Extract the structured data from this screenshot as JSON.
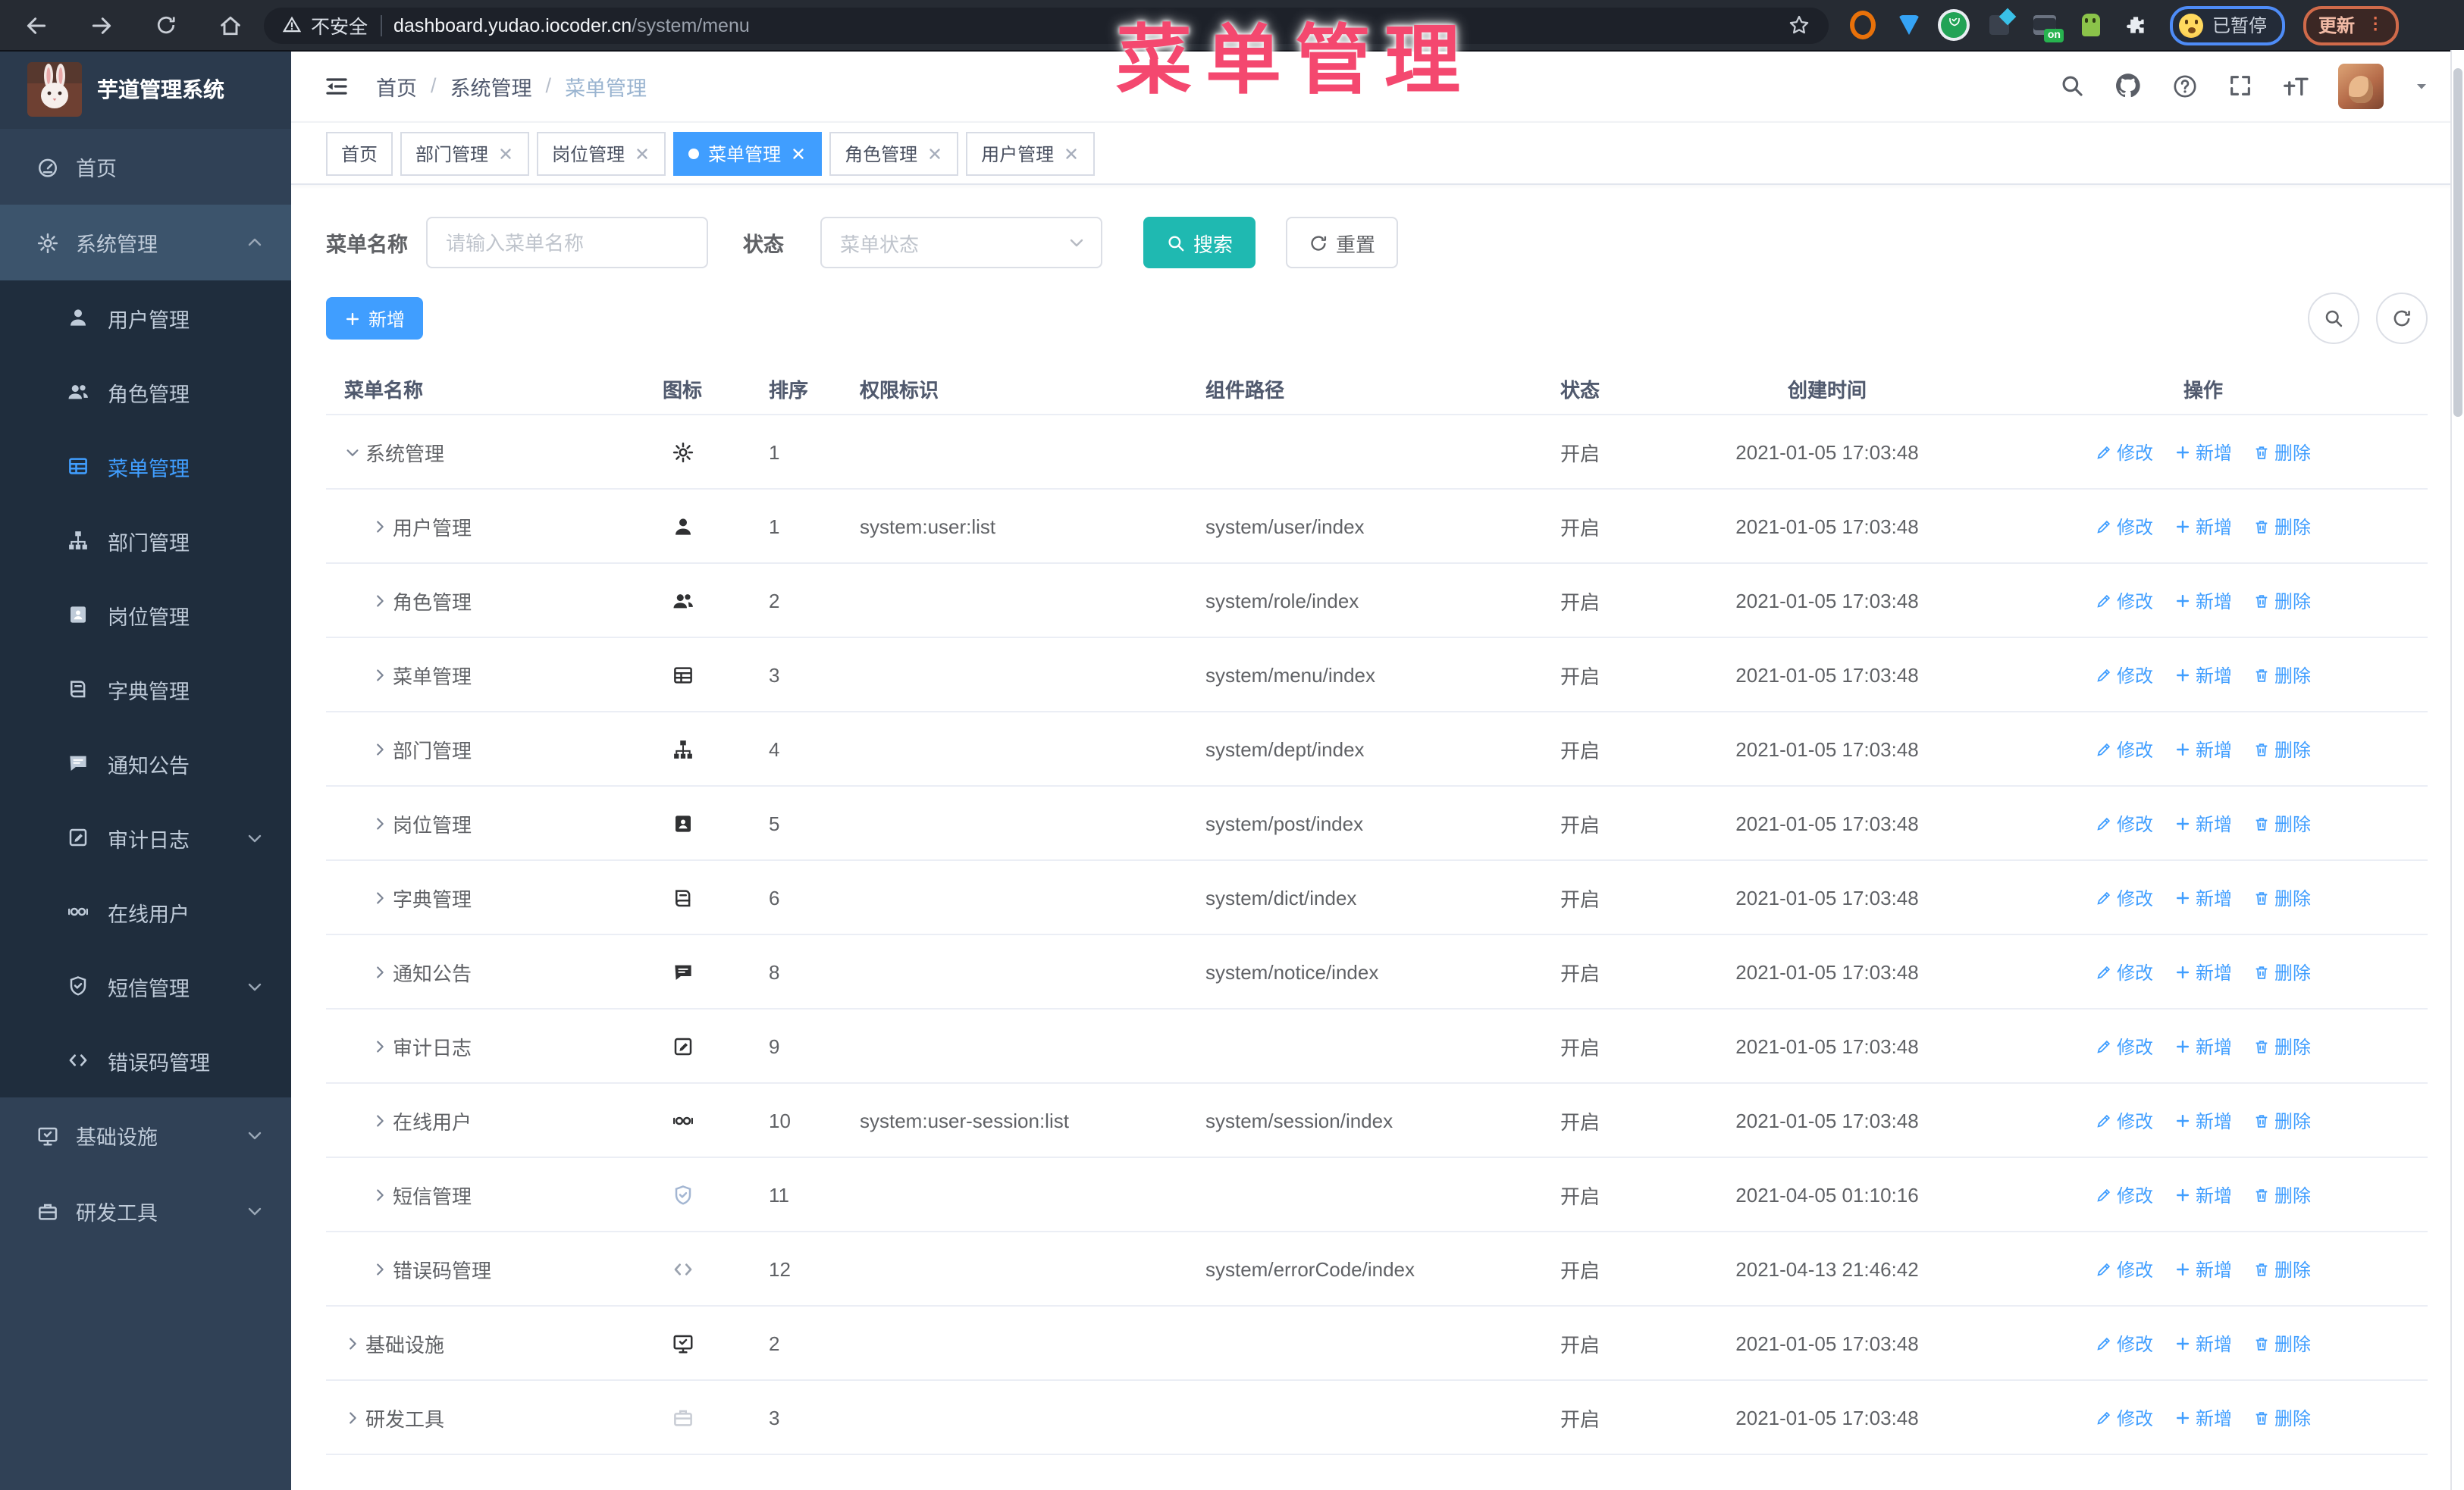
{
  "browser": {
    "security_label": "不安全",
    "url_host": "dashboard.yudao.iocoder.cn",
    "url_path": "/system/menu",
    "paused_badge": "已暂停",
    "update_button": "更新"
  },
  "annotation": {
    "text": "菜单管理",
    "color": "#f4486f"
  },
  "sidebar": {
    "logo_title": "芋道管理系统",
    "top": [
      {
        "label": "首页",
        "icon": "home"
      },
      {
        "label": "系统管理",
        "icon": "gear",
        "chevron": "up",
        "highlight": true
      }
    ],
    "submenu": [
      {
        "label": "用户管理",
        "icon": "user"
      },
      {
        "label": "角色管理",
        "icon": "users"
      },
      {
        "label": "菜单管理",
        "icon": "menu",
        "active": true
      },
      {
        "label": "部门管理",
        "icon": "tree"
      },
      {
        "label": "岗位管理",
        "icon": "post"
      },
      {
        "label": "字典管理",
        "icon": "dict"
      },
      {
        "label": "通知公告",
        "icon": "notice"
      },
      {
        "label": "审计日志",
        "icon": "log",
        "chevron": "down"
      },
      {
        "label": "在线用户",
        "icon": "online"
      },
      {
        "label": "短信管理",
        "icon": "sms",
        "chevron": "down"
      },
      {
        "label": "错误码管理",
        "icon": "code"
      }
    ],
    "bottom": [
      {
        "label": "基础设施",
        "icon": "infra",
        "chevron": "down"
      },
      {
        "label": "研发工具",
        "icon": "tool",
        "chevron": "down"
      }
    ]
  },
  "header": {
    "breadcrumb": [
      "首页",
      "系统管理",
      "菜单管理"
    ]
  },
  "tabs": [
    {
      "label": "首页",
      "closable": false,
      "active": false
    },
    {
      "label": "部门管理",
      "closable": true,
      "active": false
    },
    {
      "label": "岗位管理",
      "closable": true,
      "active": false
    },
    {
      "label": "菜单管理",
      "closable": true,
      "active": true
    },
    {
      "label": "角色管理",
      "closable": true,
      "active": false
    },
    {
      "label": "用户管理",
      "closable": true,
      "active": false
    }
  ],
  "filters": {
    "name_label": "菜单名称",
    "name_placeholder": "请输入菜单名称",
    "status_label": "状态",
    "status_placeholder": "菜单状态",
    "search_button": "搜索",
    "reset_button": "重置"
  },
  "toolbar": {
    "add_button": "新增"
  },
  "table": {
    "columns": [
      "菜单名称",
      "图标",
      "排序",
      "权限标识",
      "组件路径",
      "状态",
      "创建时间",
      "操作"
    ],
    "ops": {
      "edit": "修改",
      "add": "新增",
      "delete": "删除"
    },
    "rows": [
      {
        "name": "系统管理",
        "icon": "gear",
        "sort": "1",
        "perm": "",
        "path": "",
        "status": "开启",
        "time": "2021-01-05 17:03:48",
        "level": 0,
        "expanded": true
      },
      {
        "name": "用户管理",
        "icon": "user",
        "sort": "1",
        "perm": "system:user:list",
        "path": "system/user/index",
        "status": "开启",
        "time": "2021-01-05 17:03:48",
        "level": 1,
        "expanded": false
      },
      {
        "name": "角色管理",
        "icon": "users",
        "sort": "2",
        "perm": "",
        "path": "system/role/index",
        "status": "开启",
        "time": "2021-01-05 17:03:48",
        "level": 1,
        "expanded": false
      },
      {
        "name": "菜单管理",
        "icon": "menu",
        "sort": "3",
        "perm": "",
        "path": "system/menu/index",
        "status": "开启",
        "time": "2021-01-05 17:03:48",
        "level": 1,
        "expanded": false
      },
      {
        "name": "部门管理",
        "icon": "tree",
        "sort": "4",
        "perm": "",
        "path": "system/dept/index",
        "status": "开启",
        "time": "2021-01-05 17:03:48",
        "level": 1,
        "expanded": false
      },
      {
        "name": "岗位管理",
        "icon": "post",
        "sort": "5",
        "perm": "",
        "path": "system/post/index",
        "status": "开启",
        "time": "2021-01-05 17:03:48",
        "level": 1,
        "expanded": false
      },
      {
        "name": "字典管理",
        "icon": "dict",
        "sort": "6",
        "perm": "",
        "path": "system/dict/index",
        "status": "开启",
        "time": "2021-01-05 17:03:48",
        "level": 1,
        "expanded": false
      },
      {
        "name": "通知公告",
        "icon": "notice",
        "sort": "8",
        "perm": "",
        "path": "system/notice/index",
        "status": "开启",
        "time": "2021-01-05 17:03:48",
        "level": 1,
        "expanded": false
      },
      {
        "name": "审计日志",
        "icon": "log",
        "sort": "9",
        "perm": "",
        "path": "",
        "status": "开启",
        "time": "2021-01-05 17:03:48",
        "level": 1,
        "expanded": false
      },
      {
        "name": "在线用户",
        "icon": "online",
        "sort": "10",
        "perm": "system:user-session:list",
        "path": "system/session/index",
        "status": "开启",
        "time": "2021-01-05 17:03:48",
        "level": 1,
        "expanded": false
      },
      {
        "name": "短信管理",
        "icon": "sms",
        "sort": "11",
        "perm": "",
        "path": "",
        "status": "开启",
        "time": "2021-04-05 01:10:16",
        "level": 1,
        "expanded": false,
        "icon_color": "#a3b6d2"
      },
      {
        "name": "错误码管理",
        "icon": "code",
        "sort": "12",
        "perm": "",
        "path": "system/errorCode/index",
        "status": "开启",
        "time": "2021-04-13 21:46:42",
        "level": 1,
        "expanded": false,
        "icon_color": "#9aa2ae"
      },
      {
        "name": "基础设施",
        "icon": "infra",
        "sort": "2",
        "perm": "",
        "path": "",
        "status": "开启",
        "time": "2021-01-05 17:03:48",
        "level": 0,
        "expanded": false
      },
      {
        "name": "研发工具",
        "icon": "tool",
        "sort": "3",
        "perm": "",
        "path": "",
        "status": "开启",
        "time": "2021-01-05 17:03:48",
        "level": 0,
        "expanded": false,
        "icon_color": "#c8ccd4"
      }
    ]
  }
}
